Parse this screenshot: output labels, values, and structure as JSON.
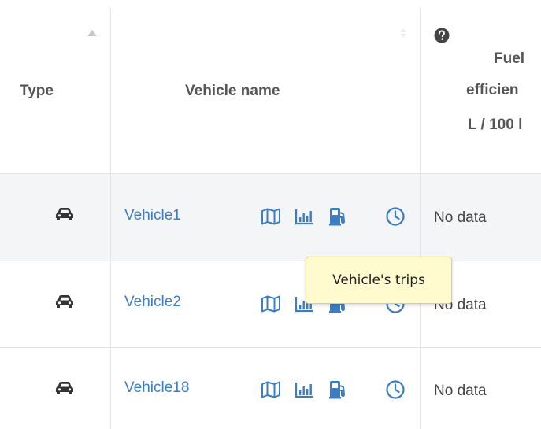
{
  "header": {
    "type_label": "Type",
    "vehicle_name_label": "Vehicle name",
    "fuel_label_line1": "Fuel",
    "fuel_label_line2": "efficien",
    "fuel_label_line3": "L / 100 l",
    "help_icon": "question-circle-icon",
    "sort_icon": "sort-asc-icon"
  },
  "rows": [
    {
      "type_icon": "car-icon",
      "name": "Vehicle1",
      "fuel_efficiency": "No data"
    },
    {
      "type_icon": "car-icon",
      "name": "Vehicle2",
      "fuel_efficiency": "No data"
    },
    {
      "type_icon": "car-icon",
      "name": "Vehicle18",
      "fuel_efficiency": "No data"
    }
  ],
  "row_actions": [
    "map-icon",
    "bar-chart-icon",
    "fuel-pump-icon",
    "clock-icon"
  ],
  "tooltip": {
    "text": "Vehicle's trips"
  },
  "colors": {
    "link": "#3b7dc4",
    "tooltip_bg": "#fffbcf",
    "row_shade": "#f4f5f7"
  }
}
